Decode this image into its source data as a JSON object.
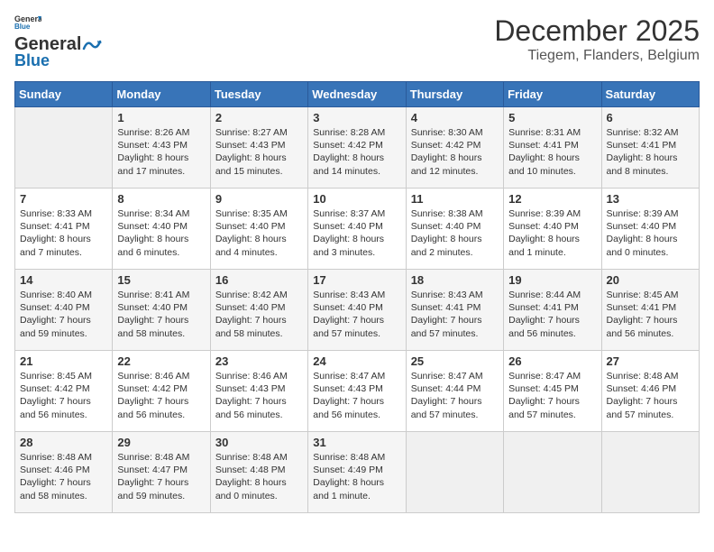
{
  "header": {
    "logo_line1": "General",
    "logo_line2": "Blue",
    "month": "December 2025",
    "location": "Tiegem, Flanders, Belgium"
  },
  "days_of_week": [
    "Sunday",
    "Monday",
    "Tuesday",
    "Wednesday",
    "Thursday",
    "Friday",
    "Saturday"
  ],
  "weeks": [
    [
      {
        "day": "",
        "content": ""
      },
      {
        "day": "1",
        "content": "Sunrise: 8:26 AM\nSunset: 4:43 PM\nDaylight: 8 hours\nand 17 minutes."
      },
      {
        "day": "2",
        "content": "Sunrise: 8:27 AM\nSunset: 4:43 PM\nDaylight: 8 hours\nand 15 minutes."
      },
      {
        "day": "3",
        "content": "Sunrise: 8:28 AM\nSunset: 4:42 PM\nDaylight: 8 hours\nand 14 minutes."
      },
      {
        "day": "4",
        "content": "Sunrise: 8:30 AM\nSunset: 4:42 PM\nDaylight: 8 hours\nand 12 minutes."
      },
      {
        "day": "5",
        "content": "Sunrise: 8:31 AM\nSunset: 4:41 PM\nDaylight: 8 hours\nand 10 minutes."
      },
      {
        "day": "6",
        "content": "Sunrise: 8:32 AM\nSunset: 4:41 PM\nDaylight: 8 hours\nand 8 minutes."
      }
    ],
    [
      {
        "day": "7",
        "content": "Sunrise: 8:33 AM\nSunset: 4:41 PM\nDaylight: 8 hours\nand 7 minutes."
      },
      {
        "day": "8",
        "content": "Sunrise: 8:34 AM\nSunset: 4:40 PM\nDaylight: 8 hours\nand 6 minutes."
      },
      {
        "day": "9",
        "content": "Sunrise: 8:35 AM\nSunset: 4:40 PM\nDaylight: 8 hours\nand 4 minutes."
      },
      {
        "day": "10",
        "content": "Sunrise: 8:37 AM\nSunset: 4:40 PM\nDaylight: 8 hours\nand 3 minutes."
      },
      {
        "day": "11",
        "content": "Sunrise: 8:38 AM\nSunset: 4:40 PM\nDaylight: 8 hours\nand 2 minutes."
      },
      {
        "day": "12",
        "content": "Sunrise: 8:39 AM\nSunset: 4:40 PM\nDaylight: 8 hours\nand 1 minute."
      },
      {
        "day": "13",
        "content": "Sunrise: 8:39 AM\nSunset: 4:40 PM\nDaylight: 8 hours\nand 0 minutes."
      }
    ],
    [
      {
        "day": "14",
        "content": "Sunrise: 8:40 AM\nSunset: 4:40 PM\nDaylight: 7 hours\nand 59 minutes."
      },
      {
        "day": "15",
        "content": "Sunrise: 8:41 AM\nSunset: 4:40 PM\nDaylight: 7 hours\nand 58 minutes."
      },
      {
        "day": "16",
        "content": "Sunrise: 8:42 AM\nSunset: 4:40 PM\nDaylight: 7 hours\nand 58 minutes."
      },
      {
        "day": "17",
        "content": "Sunrise: 8:43 AM\nSunset: 4:40 PM\nDaylight: 7 hours\nand 57 minutes."
      },
      {
        "day": "18",
        "content": "Sunrise: 8:43 AM\nSunset: 4:41 PM\nDaylight: 7 hours\nand 57 minutes."
      },
      {
        "day": "19",
        "content": "Sunrise: 8:44 AM\nSunset: 4:41 PM\nDaylight: 7 hours\nand 56 minutes."
      },
      {
        "day": "20",
        "content": "Sunrise: 8:45 AM\nSunset: 4:41 PM\nDaylight: 7 hours\nand 56 minutes."
      }
    ],
    [
      {
        "day": "21",
        "content": "Sunrise: 8:45 AM\nSunset: 4:42 PM\nDaylight: 7 hours\nand 56 minutes."
      },
      {
        "day": "22",
        "content": "Sunrise: 8:46 AM\nSunset: 4:42 PM\nDaylight: 7 hours\nand 56 minutes."
      },
      {
        "day": "23",
        "content": "Sunrise: 8:46 AM\nSunset: 4:43 PM\nDaylight: 7 hours\nand 56 minutes."
      },
      {
        "day": "24",
        "content": "Sunrise: 8:47 AM\nSunset: 4:43 PM\nDaylight: 7 hours\nand 56 minutes."
      },
      {
        "day": "25",
        "content": "Sunrise: 8:47 AM\nSunset: 4:44 PM\nDaylight: 7 hours\nand 57 minutes."
      },
      {
        "day": "26",
        "content": "Sunrise: 8:47 AM\nSunset: 4:45 PM\nDaylight: 7 hours\nand 57 minutes."
      },
      {
        "day": "27",
        "content": "Sunrise: 8:48 AM\nSunset: 4:46 PM\nDaylight: 7 hours\nand 57 minutes."
      }
    ],
    [
      {
        "day": "28",
        "content": "Sunrise: 8:48 AM\nSunset: 4:46 PM\nDaylight: 7 hours\nand 58 minutes."
      },
      {
        "day": "29",
        "content": "Sunrise: 8:48 AM\nSunset: 4:47 PM\nDaylight: 7 hours\nand 59 minutes."
      },
      {
        "day": "30",
        "content": "Sunrise: 8:48 AM\nSunset: 4:48 PM\nDaylight: 8 hours\nand 0 minutes."
      },
      {
        "day": "31",
        "content": "Sunrise: 8:48 AM\nSunset: 4:49 PM\nDaylight: 8 hours\nand 1 minute."
      },
      {
        "day": "",
        "content": ""
      },
      {
        "day": "",
        "content": ""
      },
      {
        "day": "",
        "content": ""
      }
    ]
  ]
}
